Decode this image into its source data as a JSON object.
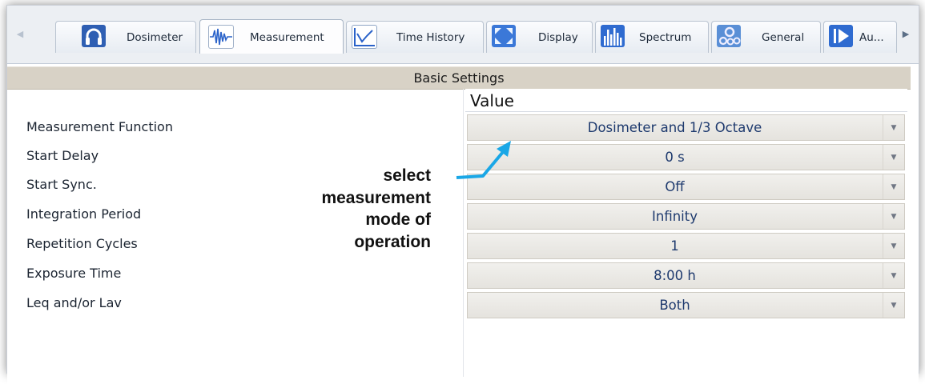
{
  "tabs": [
    {
      "label": "Dosimeter",
      "icon": "headphones-icon"
    },
    {
      "label": "Measurement",
      "icon": "waveform-icon",
      "active": true
    },
    {
      "label": "Time History",
      "icon": "line-chart-icon"
    },
    {
      "label": "Display",
      "icon": "expand-arrows-icon"
    },
    {
      "label": "Spectrum",
      "icon": "spectrum-bars-icon"
    },
    {
      "label": "General",
      "icon": "gears-icon"
    },
    {
      "label": "Au...",
      "icon": "play-icon"
    }
  ],
  "section": {
    "title": "Basic Settings",
    "value_header": "Value"
  },
  "settings": [
    {
      "label": "Measurement Function",
      "value": "Dosimeter and 1/3 Octave"
    },
    {
      "label": "Start Delay",
      "value": "0 s"
    },
    {
      "label": "Start Sync.",
      "value": "Off"
    },
    {
      "label": "Integration Period",
      "value": "Infinity"
    },
    {
      "label": "Repetition Cycles",
      "value": "1"
    },
    {
      "label": "Exposure Time",
      "value": "8:00 h"
    },
    {
      "label": "Leq and/or Lav",
      "value": "Both"
    }
  ],
  "annotation": {
    "lines": [
      "select",
      "measurement",
      "mode of",
      "operation"
    ],
    "arrow_color": "#1aa7e6"
  },
  "colors": {
    "accent_blue": "#1e3a6e",
    "section_header_bg": "#d8d2c6",
    "value_cell_bg": "#e9e7e2"
  }
}
